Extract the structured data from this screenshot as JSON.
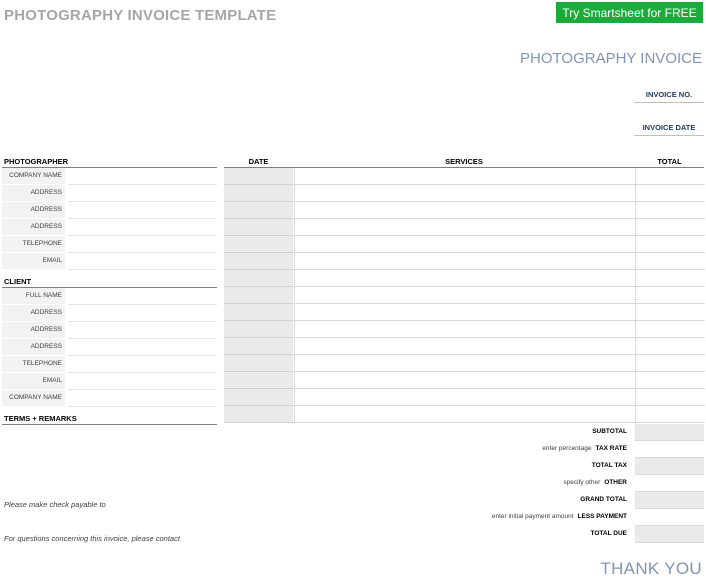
{
  "header": {
    "template_title": "PHOTOGRAPHY INVOICE TEMPLATE",
    "cta_button": "Try Smartsheet for FREE",
    "invoice_title": "PHOTOGRAPHY INVOICE",
    "invoice_no_label": "INVOICE NO.",
    "invoice_date_label": "INVOICE DATE"
  },
  "photographer": {
    "heading": "PHOTOGRAPHER",
    "fields": [
      "COMPANY NAME",
      "ADDRESS",
      "ADDRESS",
      "ADDRESS",
      "TELEPHONE",
      "EMAIL"
    ]
  },
  "client": {
    "heading": "CLIENT",
    "fields": [
      "FULL NAME",
      "ADDRESS",
      "ADDRESS",
      "ADDRESS",
      "TELEPHONE",
      "EMAIL",
      "COMPANY NAME"
    ]
  },
  "terms": {
    "heading": "TERMS + REMARKS",
    "payable_note": "Please make check payable to",
    "questions_note": "For questions concerning this invoice, please contact"
  },
  "table": {
    "columns": [
      "DATE",
      "SERVICES",
      "TOTAL"
    ]
  },
  "totals": [
    {
      "prefix": "",
      "label": "SUBTOTAL",
      "shaded": true
    },
    {
      "prefix": "enter percentage",
      "label": "TAX RATE",
      "shaded": false
    },
    {
      "prefix": "",
      "label": "TOTAL TAX",
      "shaded": true
    },
    {
      "prefix": "specify other",
      "label": "OTHER",
      "shaded": false
    },
    {
      "prefix": "",
      "label": "GRAND TOTAL",
      "shaded": true
    },
    {
      "prefix": "enter initial payment amount",
      "label": "LESS PAYMENT",
      "shaded": false
    },
    {
      "prefix": "",
      "label": "TOTAL DUE",
      "shaded": true
    }
  ],
  "footer": {
    "thanks": "THANK YOU"
  },
  "colors": {
    "cta_bg": "#1aab3a",
    "accent_title": "#8195b4",
    "meta_label": "#1f3c64",
    "shade": "#eaeaea"
  }
}
